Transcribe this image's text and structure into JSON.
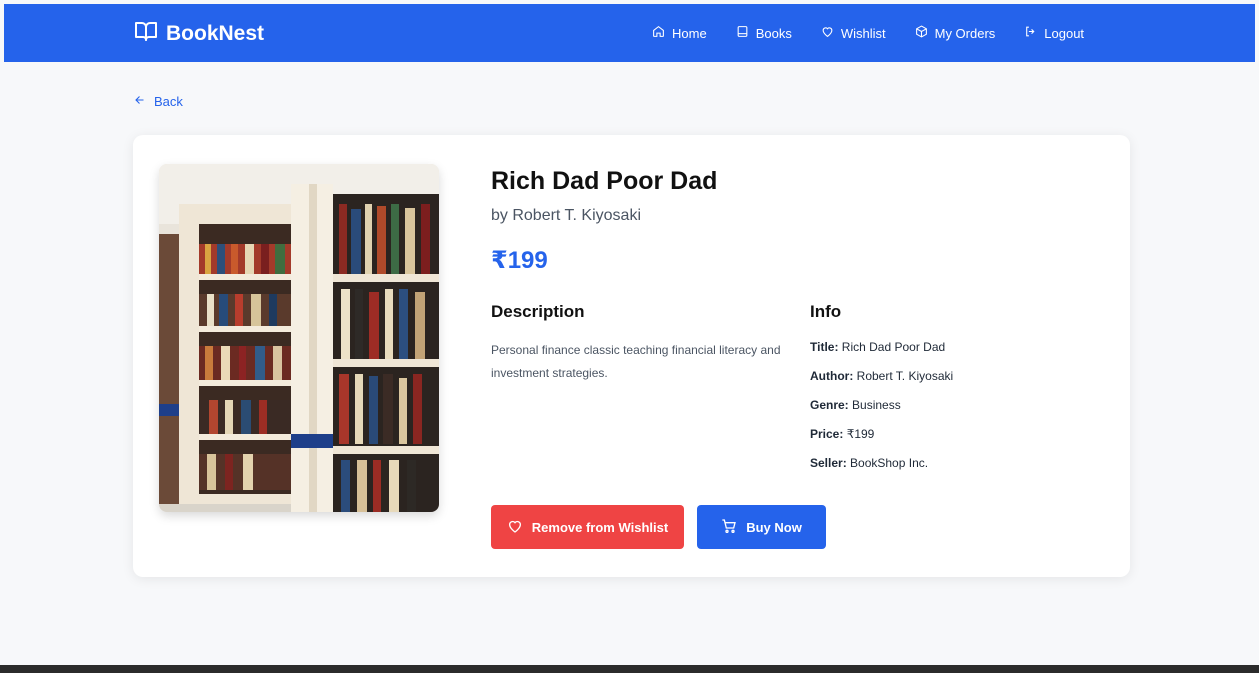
{
  "app": {
    "brand": "BookNest"
  },
  "nav": [
    {
      "label": "Home",
      "icon": "home-icon"
    },
    {
      "label": "Books",
      "icon": "book-icon"
    },
    {
      "label": "Wishlist",
      "icon": "heart-icon"
    },
    {
      "label": "My Orders",
      "icon": "package-icon"
    },
    {
      "label": "Logout",
      "icon": "logout-icon"
    }
  ],
  "back_label": "Back",
  "book": {
    "title": "Rich Dad Poor Dad",
    "author_line": "by Robert T. Kiyosaki",
    "price": "₹199",
    "description_heading": "Description",
    "description": "Personal finance classic teaching financial literacy and investment strategies.",
    "info_heading": "Info",
    "info": [
      {
        "label": "Title:",
        "value": "Rich Dad Poor Dad"
      },
      {
        "label": "Author:",
        "value": "Robert T. Kiyosaki"
      },
      {
        "label": "Genre:",
        "value": "Business"
      },
      {
        "label": "Price:",
        "value": "₹199"
      },
      {
        "label": "Seller:",
        "value": "BookShop Inc."
      }
    ]
  },
  "actions": {
    "remove_label": "Remove from Wishlist",
    "buy_label": "Buy Now"
  },
  "colors": {
    "primary": "#2563eb",
    "danger": "#ef4444",
    "background": "#f7f8fa"
  }
}
